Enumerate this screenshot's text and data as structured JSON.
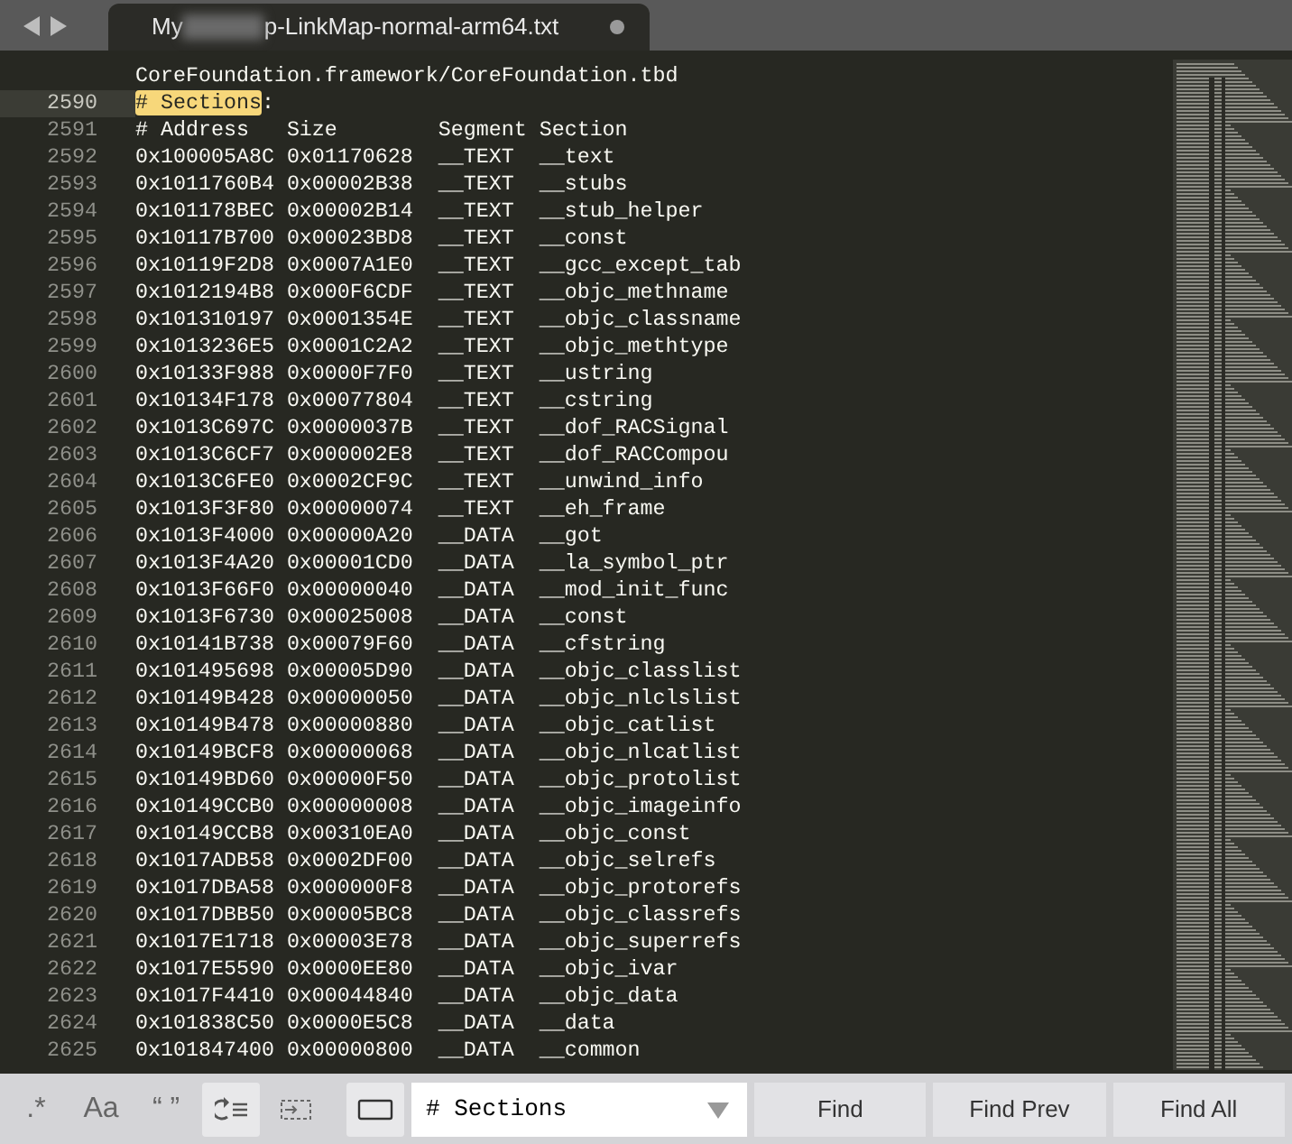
{
  "tab": {
    "title_start": "My",
    "title": "p-LinkMap-normal-arm64.txt",
    "redacted": true,
    "modified": true
  },
  "editor": {
    "lines": [
      {
        "text": "CoreFoundation.framework/CoreFoundation.tbd",
        "current": false
      },
      {
        "number": "2590",
        "match": "# Sections",
        "text": ":",
        "current": true
      },
      {
        "number": "2591",
        "text": "# Address   Size        Segment Section",
        "current": false
      },
      {
        "number": "2592",
        "text": "0x100005A8C 0x01170628  __TEXT  __text",
        "current": false
      },
      {
        "number": "2593",
        "text": "0x1011760B4 0x00002B38  __TEXT  __stubs",
        "current": false
      },
      {
        "number": "2594",
        "text": "0x101178BEC 0x00002B14  __TEXT  __stub_helper",
        "current": false
      },
      {
        "number": "2595",
        "text": "0x10117B700 0x00023BD8  __TEXT  __const",
        "current": false
      },
      {
        "number": "2596",
        "text": "0x10119F2D8 0x0007A1E0  __TEXT  __gcc_except_tab",
        "current": false
      },
      {
        "number": "2597",
        "text": "0x1012194B8 0x000F6CDF  __TEXT  __objc_methname",
        "current": false
      },
      {
        "number": "2598",
        "text": "0x101310197 0x0001354E  __TEXT  __objc_classname",
        "current": false
      },
      {
        "number": "2599",
        "text": "0x1013236E5 0x0001C2A2  __TEXT  __objc_methtype",
        "current": false
      },
      {
        "number": "2600",
        "text": "0x10133F988 0x0000F7F0  __TEXT  __ustring",
        "current": false
      },
      {
        "number": "2601",
        "text": "0x10134F178 0x00077804  __TEXT  __cstring",
        "current": false
      },
      {
        "number": "2602",
        "text": "0x1013C697C 0x0000037B  __TEXT  __dof_RACSignal",
        "current": false
      },
      {
        "number": "2603",
        "text": "0x1013C6CF7 0x000002E8  __TEXT  __dof_RACCompou",
        "current": false
      },
      {
        "number": "2604",
        "text": "0x1013C6FE0 0x0002CF9C  __TEXT  __unwind_info",
        "current": false
      },
      {
        "number": "2605",
        "text": "0x1013F3F80 0x00000074  __TEXT  __eh_frame",
        "current": false
      },
      {
        "number": "2606",
        "text": "0x1013F4000 0x00000A20  __DATA  __got",
        "current": false
      },
      {
        "number": "2607",
        "text": "0x1013F4A20 0x00001CD0  __DATA  __la_symbol_ptr",
        "current": false
      },
      {
        "number": "2608",
        "text": "0x1013F66F0 0x00000040  __DATA  __mod_init_func",
        "current": false
      },
      {
        "number": "2609",
        "text": "0x1013F6730 0x00025008  __DATA  __const",
        "current": false
      },
      {
        "number": "2610",
        "text": "0x10141B738 0x00079F60  __DATA  __cfstring",
        "current": false
      },
      {
        "number": "2611",
        "text": "0x101495698 0x00005D90  __DATA  __objc_classlist",
        "current": false
      },
      {
        "number": "2612",
        "text": "0x10149B428 0x00000050  __DATA  __objc_nlclslist",
        "current": false
      },
      {
        "number": "2613",
        "text": "0x10149B478 0x00000880  __DATA  __objc_catlist",
        "current": false
      },
      {
        "number": "2614",
        "text": "0x10149BCF8 0x00000068  __DATA  __objc_nlcatlist",
        "current": false
      },
      {
        "number": "2615",
        "text": "0x10149BD60 0x00000F50  __DATA  __objc_protolist",
        "current": false
      },
      {
        "number": "2616",
        "text": "0x10149CCB0 0x00000008  __DATA  __objc_imageinfo",
        "current": false
      },
      {
        "number": "2617",
        "text": "0x10149CCB8 0x00310EA0  __DATA  __objc_const",
        "current": false
      },
      {
        "number": "2618",
        "text": "0x1017ADB58 0x0002DF00  __DATA  __objc_selrefs",
        "current": false
      },
      {
        "number": "2619",
        "text": "0x1017DBA58 0x000000F8  __DATA  __objc_protorefs",
        "current": false
      },
      {
        "number": "2620",
        "text": "0x1017DBB50 0x00005BC8  __DATA  __objc_classrefs",
        "current": false
      },
      {
        "number": "2621",
        "text": "0x1017E1718 0x00003E78  __DATA  __objc_superrefs",
        "current": false
      },
      {
        "number": "2622",
        "text": "0x1017E5590 0x0000EE80  __DATA  __objc_ivar",
        "current": false
      },
      {
        "number": "2623",
        "text": "0x1017F4410 0x00044840  __DATA  __objc_data",
        "current": false
      },
      {
        "number": "2624",
        "text": "0x101838C50 0x0000E5C8  __DATA  __data",
        "current": false
      },
      {
        "number": "2625",
        "text": "0x101847400 0x00000800  __DATA  __common",
        "current": false
      }
    ]
  },
  "find_bar": {
    "toggles": [
      {
        "kind": "regex",
        "label": ".*",
        "on": false
      },
      {
        "kind": "case",
        "label": "Aa",
        "on": false
      },
      {
        "kind": "word",
        "label": "“ ”",
        "on": false
      },
      {
        "kind": "wrap",
        "on": true
      },
      {
        "kind": "selection",
        "on": false
      },
      {
        "kind": "highlight",
        "on": true
      }
    ],
    "search": {
      "value": "# Sections"
    },
    "buttons": [
      "Find",
      "Find Prev",
      "Find All"
    ]
  }
}
